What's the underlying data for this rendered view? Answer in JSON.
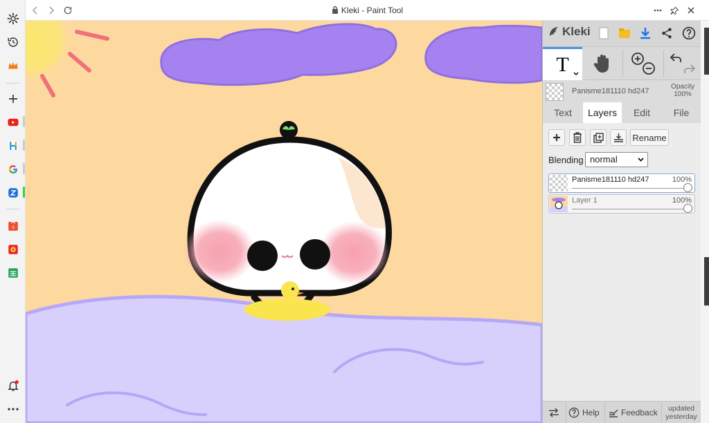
{
  "window": {
    "title": "Kleki - Paint Tool"
  },
  "colors": {
    "sky": "#fdd9a0",
    "cloud": "#a582f0",
    "sun": "#fbe76e",
    "blanket": "#d8d0fc",
    "blush": "#f7a4b2",
    "accent": "#4a8ee6"
  },
  "sidebar": {
    "items": [
      {
        "icon": "settings-icon"
      },
      {
        "icon": "history-icon"
      },
      {
        "icon": "crown-icon"
      },
      {
        "icon": "add-icon"
      },
      {
        "icon": "youtube-icon"
      },
      {
        "icon": "h-app-icon"
      },
      {
        "icon": "google-icon"
      },
      {
        "icon": "z-app-icon"
      },
      {
        "icon": "shopee-icon"
      },
      {
        "icon": "game-icon"
      },
      {
        "icon": "sheets-icon"
      },
      {
        "icon": "notification-bell-icon"
      },
      {
        "icon": "more-icon"
      }
    ]
  },
  "kleki": {
    "logo": "Kleki",
    "tools": [
      {
        "name": "text-tool",
        "icon": "T"
      },
      {
        "name": "hand-tool",
        "icon": "hand-icon"
      },
      {
        "name": "zoom-tool",
        "icon": "zoom-in-out-icon"
      },
      {
        "name": "undo-redo",
        "icon": "undo-redo-icon"
      }
    ],
    "current_layer": {
      "name": "Panisme181110 hd247",
      "opacity_label": "Opacity",
      "opacity_value": "100%"
    },
    "tabs": [
      "Text",
      "Layers",
      "Edit",
      "File"
    ],
    "active_tab": "Layers",
    "layers_panel": {
      "rename_label": "Rename",
      "blending_label": "Blending",
      "blending_value": "normal",
      "layers": [
        {
          "name": "Panisme181110 hd247",
          "opacity": "100%",
          "opacity_fraction": 1.0,
          "selected": true
        },
        {
          "name": "Layer 1",
          "opacity": "100%",
          "opacity_fraction": 1.0,
          "selected": false
        }
      ]
    },
    "footer": {
      "help_label": "Help",
      "feedback_label": "Feedback",
      "updated_line1": "updated",
      "updated_line2": "yesterday"
    }
  }
}
